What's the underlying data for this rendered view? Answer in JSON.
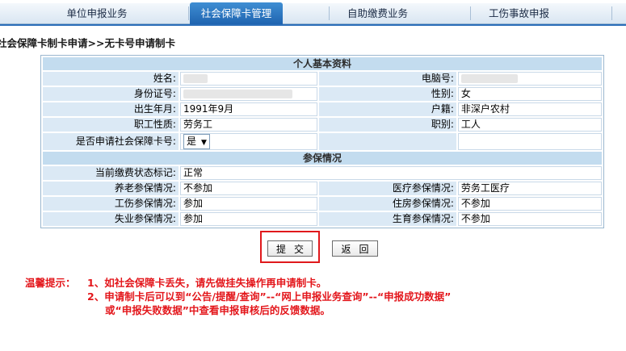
{
  "tabs": [
    {
      "label": "单位申报业务",
      "active": false
    },
    {
      "label": "社会保障卡管理",
      "active": true
    },
    {
      "label": "自助缴费业务",
      "active": false
    },
    {
      "label": "工伤事故申报",
      "active": false
    }
  ],
  "breadcrumb": "社会保障卡制卡申请>>无卡号申请制卡",
  "basic_section": {
    "title": "个人基本资料",
    "rows": [
      {
        "l1": "姓名:",
        "v1": "",
        "l2": "电脑号:",
        "v2": ""
      },
      {
        "l1": "身份证号:",
        "v1": "",
        "l2": "性别:",
        "v2": "女"
      },
      {
        "l1": "出生年月:",
        "v1": "1991年9月",
        "l2": "户籍:",
        "v2": "非深户农村"
      },
      {
        "l1": "职工性质:",
        "v1": "劳务工",
        "l2": "职别:",
        "v2": "工人"
      }
    ],
    "apply_label": "是否申请社会保障卡号:",
    "apply_value": "是"
  },
  "insurance_section": {
    "title": "参保情况",
    "status_label": "当前缴费状态标记:",
    "status_value": "正常",
    "rows": [
      {
        "l1": "养老参保情况:",
        "v1": "不参加",
        "l2": "医疗参保情况:",
        "v2": "劳务工医疗"
      },
      {
        "l1": "工伤参保情况:",
        "v1": "参加",
        "l2": "住房参保情况:",
        "v2": "不参加"
      },
      {
        "l1": "失业参保情况:",
        "v1": "参加",
        "l2": "生育参保情况:",
        "v2": "不参加"
      }
    ]
  },
  "buttons": {
    "submit": "提交",
    "back": "返回"
  },
  "tips": {
    "prefix": "温馨提示：",
    "line1": "1、如社会保障卡丢失，请先做挂失操作再申请制卡。",
    "line2": "2、申请制卡后可以到“公告/提醒/查询”--“网上申报业务查询”--“申报成功数据”",
    "line3": "或“申报失败数据”中查看申报审核后的反馈数据。"
  },
  "colors": {
    "tip_red": "#e3161b",
    "active_tab": "#2a6db8",
    "header_cell": "#c3dcef",
    "label_cell": "#dbe9f5"
  }
}
